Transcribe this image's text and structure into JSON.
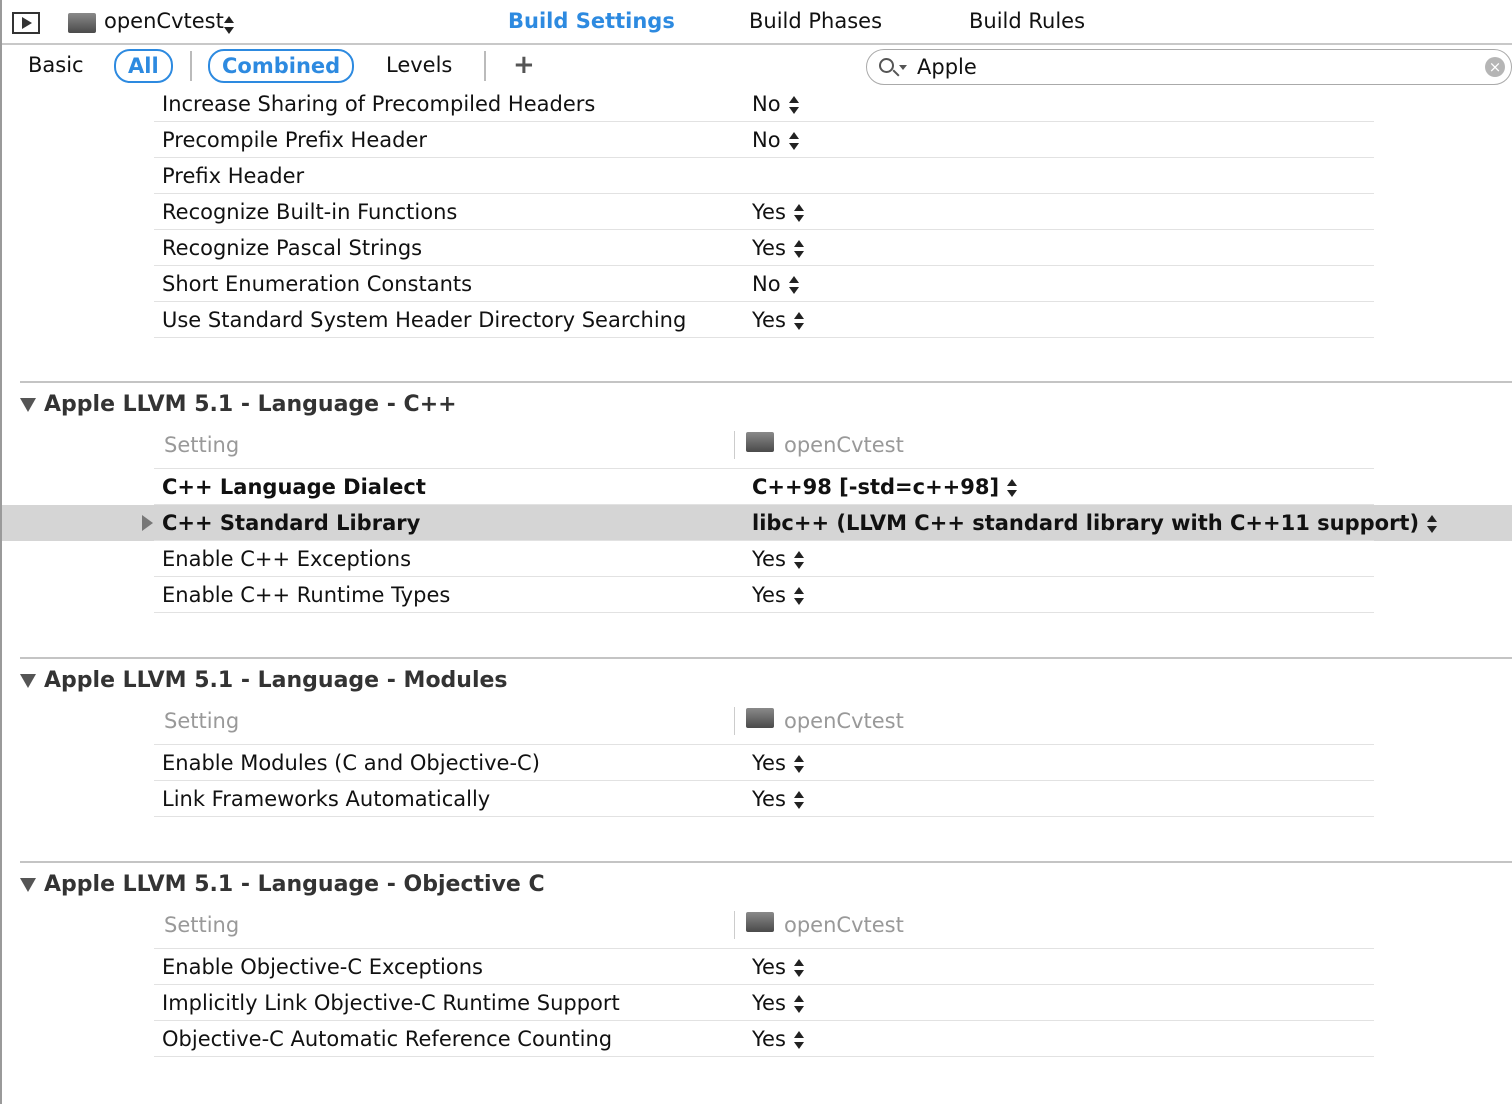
{
  "toolbar": {
    "target": "openCvtest",
    "tabs": [
      "Build Settings",
      "Build Phases",
      "Build Rules"
    ],
    "active_tab": "Build Settings"
  },
  "filter": {
    "basic": "Basic",
    "all": "All",
    "combined": "Combined",
    "levels": "Levels",
    "add": "+",
    "search_value": "Apple",
    "accent": "#2d8ae0"
  },
  "group0": {
    "rows": [
      {
        "label": "Increase Sharing of Precompiled Headers",
        "value": "No"
      },
      {
        "label": "Precompile Prefix Header",
        "value": "No"
      },
      {
        "label": "Prefix Header",
        "value": ""
      },
      {
        "label": "Recognize Built-in Functions",
        "value": "Yes"
      },
      {
        "label": "Recognize Pascal Strings",
        "value": "Yes"
      },
      {
        "label": "Short Enumeration Constants",
        "value": "No"
      },
      {
        "label": "Use Standard System Header Directory Searching",
        "value": "Yes"
      }
    ]
  },
  "sections": [
    {
      "title": "Apple LLVM 5.1 - Language - C++",
      "setting_header": "Setting",
      "target_header": "openCvtest",
      "rows": [
        {
          "label": "C++ Language Dialect",
          "value": "C++98 [-std=c++98]",
          "bold": true
        },
        {
          "label": "C++ Standard Library",
          "value": "libc++ (LLVM C++ standard library with C++11 support)",
          "bold": true,
          "selected": true,
          "expandable": true
        },
        {
          "label": "Enable C++ Exceptions",
          "value": "Yes"
        },
        {
          "label": "Enable C++ Runtime Types",
          "value": "Yes"
        }
      ]
    },
    {
      "title": "Apple LLVM 5.1 - Language - Modules",
      "setting_header": "Setting",
      "target_header": "openCvtest",
      "rows": [
        {
          "label": "Enable Modules (C and Objective-C)",
          "value": "Yes"
        },
        {
          "label": "Link Frameworks Automatically",
          "value": "Yes"
        }
      ]
    },
    {
      "title": "Apple LLVM 5.1 - Language - Objective C",
      "setting_header": "Setting",
      "target_header": "openCvtest",
      "rows": [
        {
          "label": "Enable Objective-C Exceptions",
          "value": "Yes"
        },
        {
          "label": "Implicitly Link Objective-C Runtime Support",
          "value": "Yes"
        },
        {
          "label": "Objective-C Automatic Reference Counting",
          "value": "Yes"
        }
      ]
    }
  ]
}
